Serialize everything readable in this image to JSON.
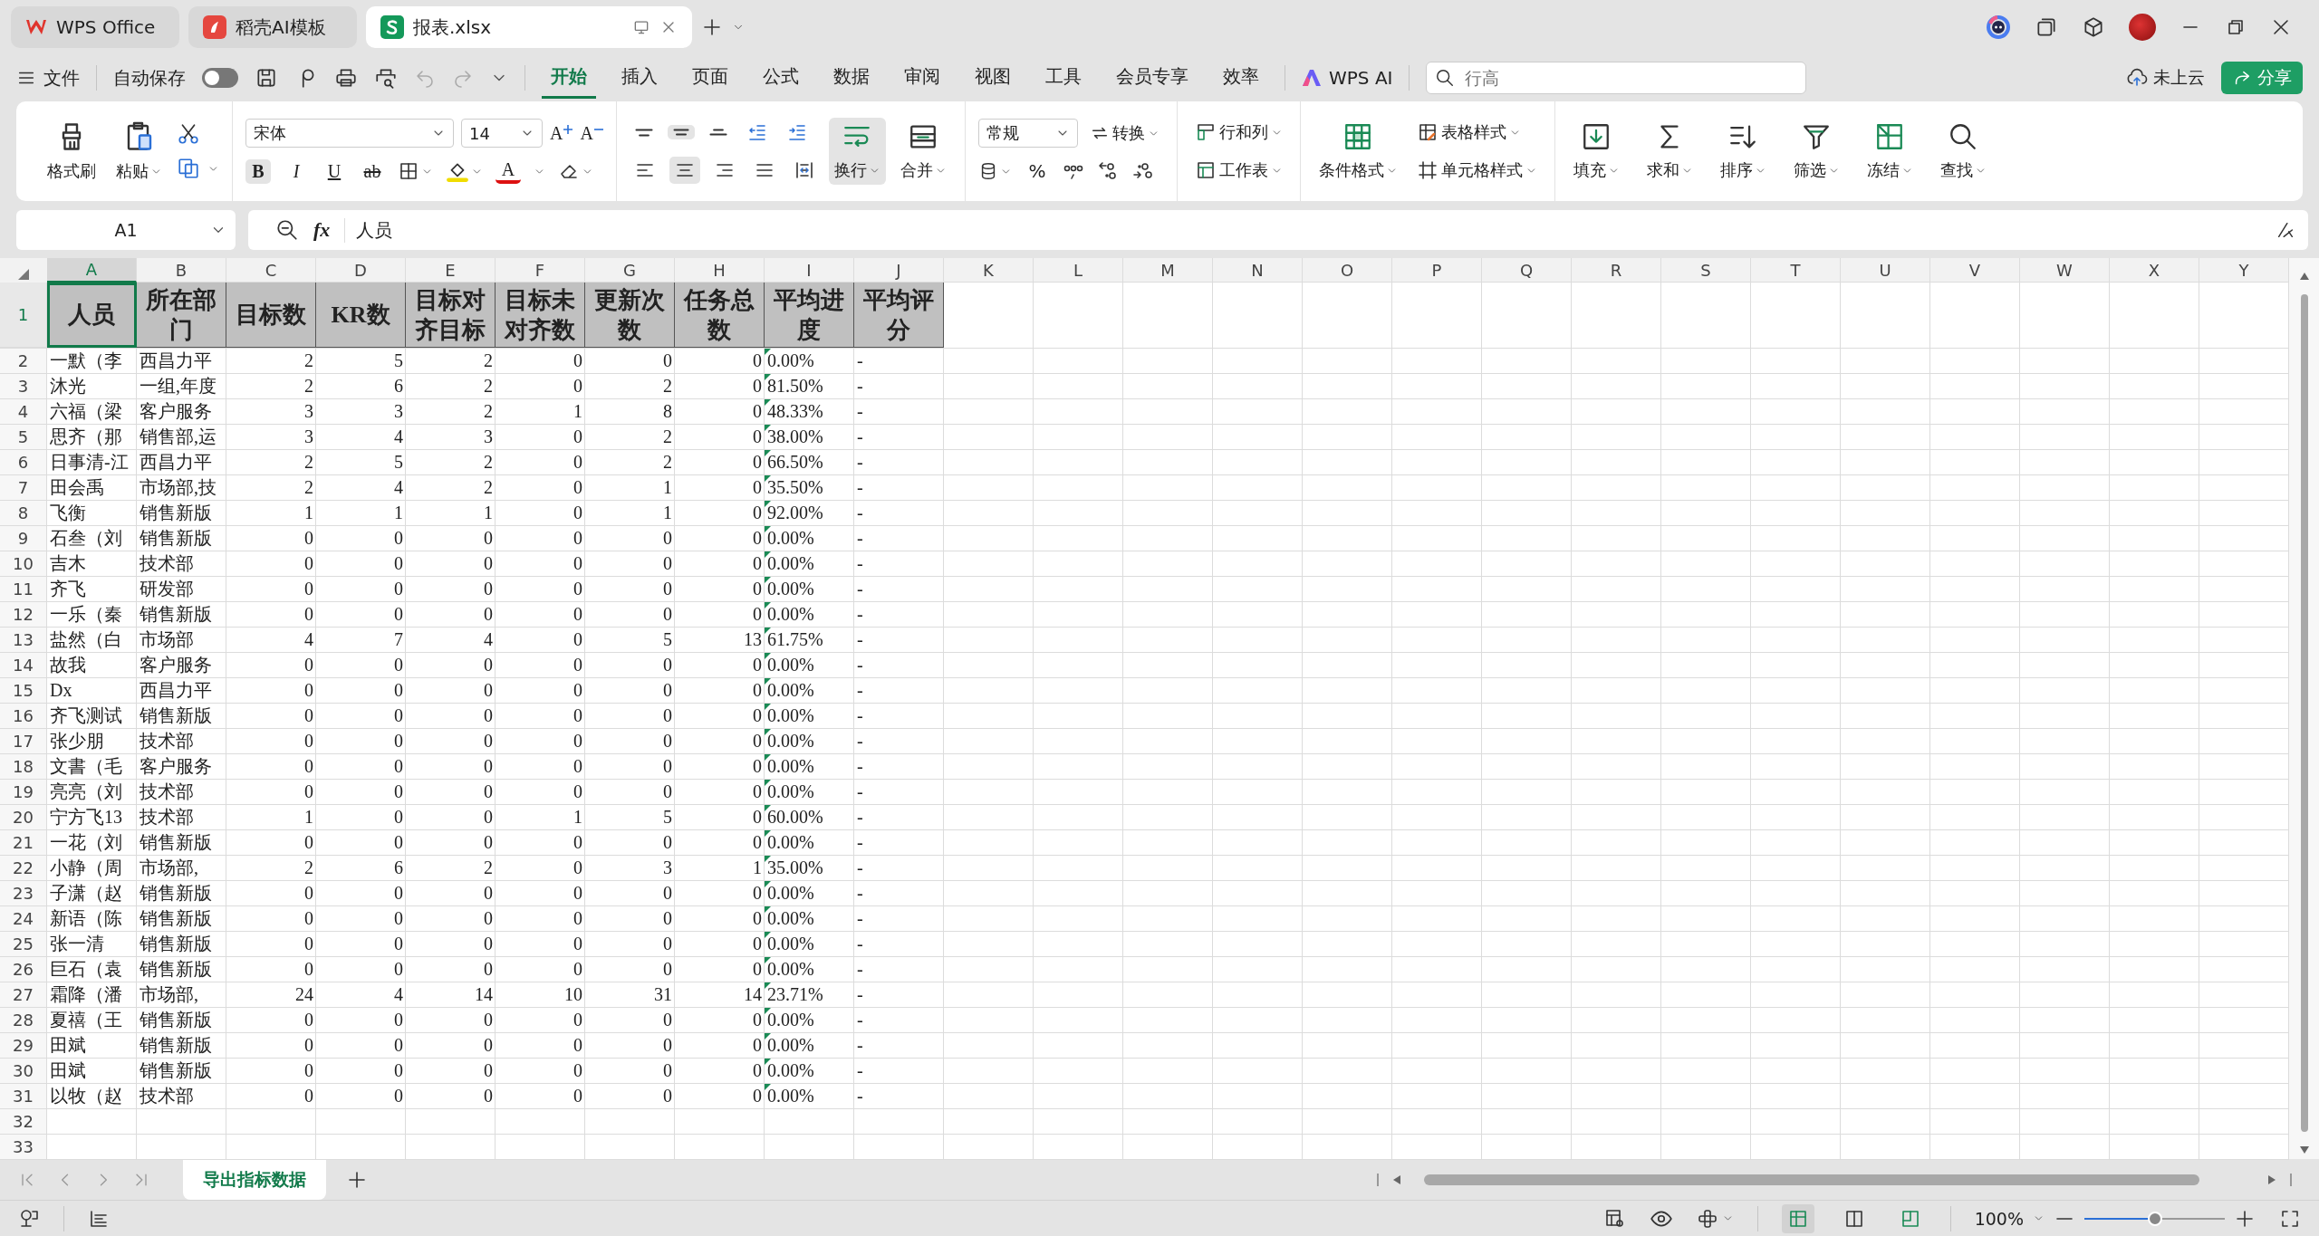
{
  "title_tabs": [
    {
      "label": "WPS Office",
      "kind": "wps",
      "selected": false
    },
    {
      "label": "稻壳AI模板",
      "kind": "docer",
      "selected": false
    },
    {
      "label": "报表.xlsx",
      "kind": "sheet",
      "selected": true
    }
  ],
  "menu": {
    "file": "文件",
    "autosave": {
      "label": "自动保存",
      "on": false
    },
    "tabs": [
      {
        "label": "开始",
        "selected": true
      },
      {
        "label": "插入",
        "selected": false
      },
      {
        "label": "页面",
        "selected": false
      },
      {
        "label": "公式",
        "selected": false
      },
      {
        "label": "数据",
        "selected": false
      },
      {
        "label": "审阅",
        "selected": false
      },
      {
        "label": "视图",
        "selected": false
      },
      {
        "label": "工具",
        "selected": false
      },
      {
        "label": "会员专享",
        "selected": false
      },
      {
        "label": "效率",
        "selected": false
      }
    ],
    "ai": "WPS AI",
    "search": {
      "placeholder": "行高"
    },
    "cloud": "未上云",
    "share": "分享"
  },
  "ribbon": {
    "clipboard": [
      "格式刷",
      "粘贴"
    ],
    "font": {
      "name": "宋体",
      "size": "14",
      "grow": "A",
      "shrink": "A",
      "bold": {
        "label": "B",
        "on": true
      },
      "italic": "I",
      "underline": "U",
      "strike": "ab",
      "color_letter": "A"
    },
    "align": [
      {
        "kind": "top",
        "selected": false
      },
      {
        "kind": "middle",
        "selected": true
      },
      {
        "kind": "bottom",
        "selected": false
      },
      {
        "kind": "outdent",
        "selected": false
      },
      {
        "kind": "indent",
        "selected": false
      },
      {
        "kind": "left",
        "selected": false
      },
      {
        "kind": "center",
        "selected": true
      },
      {
        "kind": "right",
        "selected": false
      },
      {
        "kind": "justify",
        "selected": false
      },
      {
        "kind": "distributed",
        "selected": false
      }
    ],
    "wrap": {
      "label": "换行",
      "on": true
    },
    "merge": "合并",
    "number_format": "常规",
    "convert": "转换",
    "percent": "%",
    "rows_cols": "行和列",
    "worksheet": "工作表",
    "cond_format": "条件格式",
    "table_style": "表格样式",
    "cell_style": "单元格样式",
    "tools": [
      {
        "label": "填充",
        "kind": "fill"
      },
      {
        "label": "求和",
        "kind": "sum"
      },
      {
        "label": "排序",
        "kind": "sort"
      },
      {
        "label": "筛选",
        "kind": "filter"
      },
      {
        "label": "冻结",
        "kind": "freeze"
      },
      {
        "label": "查找",
        "kind": "find"
      }
    ]
  },
  "formula": {
    "name_box": "A1",
    "fx": "fx",
    "value": "人员"
  },
  "sheet": {
    "columns": [
      {
        "letter": "A",
        "header": "人员",
        "kind": "text",
        "selected": true
      },
      {
        "letter": "B",
        "header": "所在部门",
        "kind": "text",
        "selected": false
      },
      {
        "letter": "C",
        "header": "目标数",
        "kind": "number",
        "selected": false
      },
      {
        "letter": "D",
        "header": "KR数",
        "kind": "number",
        "selected": false
      },
      {
        "letter": "E",
        "header": "目标对齐目标",
        "kind": "number",
        "selected": false
      },
      {
        "letter": "F",
        "header": "目标未对齐数",
        "kind": "number",
        "selected": false
      },
      {
        "letter": "G",
        "header": "更新次数",
        "kind": "number",
        "selected": false
      },
      {
        "letter": "H",
        "header": "任务总数",
        "kind": "number",
        "selected": false
      },
      {
        "letter": "I",
        "header": "平均进度",
        "kind": "percent",
        "selected": false
      },
      {
        "letter": "J",
        "header": "平均评分",
        "kind": "text",
        "selected": false
      }
    ],
    "empty_columns": [
      "K",
      "L",
      "M",
      "N",
      "O",
      "P",
      "Q",
      "R",
      "S",
      "T",
      "U",
      "V",
      "W",
      "X",
      "Y"
    ],
    "header_row": {
      "number": "1",
      "selected": true
    },
    "rows": [
      {
        "number": "2",
        "cells": [
          "一默（李",
          "西昌力平",
          "2",
          "5",
          "2",
          "0",
          "0",
          "0",
          "0.00%",
          "-"
        ]
      },
      {
        "number": "3",
        "cells": [
          "沐光",
          "一组,年度",
          "2",
          "6",
          "2",
          "0",
          "2",
          "0",
          "81.50%",
          "-"
        ]
      },
      {
        "number": "4",
        "cells": [
          "六福（梁",
          "客户服务",
          "3",
          "3",
          "2",
          "1",
          "8",
          "0",
          "48.33%",
          "-"
        ]
      },
      {
        "number": "5",
        "cells": [
          "思齐（那",
          "销售部,运",
          "3",
          "4",
          "3",
          "0",
          "2",
          "0",
          "38.00%",
          "-"
        ]
      },
      {
        "number": "6",
        "cells": [
          "日事清-江",
          "西昌力平",
          "2",
          "5",
          "2",
          "0",
          "2",
          "0",
          "66.50%",
          "-"
        ]
      },
      {
        "number": "7",
        "cells": [
          "田会禹",
          "市场部,技",
          "2",
          "4",
          "2",
          "0",
          "1",
          "0",
          "35.50%",
          "-"
        ]
      },
      {
        "number": "8",
        "cells": [
          "飞衡",
          "销售新版",
          "1",
          "1",
          "1",
          "0",
          "1",
          "0",
          "92.00%",
          "-"
        ]
      },
      {
        "number": "9",
        "cells": [
          "石叁（刘",
          "销售新版",
          "0",
          "0",
          "0",
          "0",
          "0",
          "0",
          "0.00%",
          "-"
        ]
      },
      {
        "number": "10",
        "cells": [
          "吉木",
          "技术部",
          "0",
          "0",
          "0",
          "0",
          "0",
          "0",
          "0.00%",
          "-"
        ]
      },
      {
        "number": "11",
        "cells": [
          "齐飞",
          "研发部",
          "0",
          "0",
          "0",
          "0",
          "0",
          "0",
          "0.00%",
          "-"
        ]
      },
      {
        "number": "12",
        "cells": [
          "一乐（秦",
          "销售新版",
          "0",
          "0",
          "0",
          "0",
          "0",
          "0",
          "0.00%",
          "-"
        ]
      },
      {
        "number": "13",
        "cells": [
          "盐然（白",
          "市场部",
          "4",
          "7",
          "4",
          "0",
          "5",
          "13",
          "61.75%",
          "-"
        ]
      },
      {
        "number": "14",
        "cells": [
          "故我",
          "客户服务",
          "0",
          "0",
          "0",
          "0",
          "0",
          "0",
          "0.00%",
          "-"
        ]
      },
      {
        "number": "15",
        "cells": [
          "Dx",
          "西昌力平",
          "0",
          "0",
          "0",
          "0",
          "0",
          "0",
          "0.00%",
          "-"
        ]
      },
      {
        "number": "16",
        "cells": [
          "齐飞测试",
          "销售新版",
          "0",
          "0",
          "0",
          "0",
          "0",
          "0",
          "0.00%",
          "-"
        ]
      },
      {
        "number": "17",
        "cells": [
          "张少朋",
          "技术部",
          "0",
          "0",
          "0",
          "0",
          "0",
          "0",
          "0.00%",
          "-"
        ]
      },
      {
        "number": "18",
        "cells": [
          "文書（毛",
          "客户服务",
          "0",
          "0",
          "0",
          "0",
          "0",
          "0",
          "0.00%",
          "-"
        ]
      },
      {
        "number": "19",
        "cells": [
          "亮亮（刘",
          "技术部",
          "0",
          "0",
          "0",
          "0",
          "0",
          "0",
          "0.00%",
          "-"
        ]
      },
      {
        "number": "20",
        "cells": [
          "宁方飞13",
          "技术部",
          "1",
          "0",
          "0",
          "1",
          "5",
          "0",
          "60.00%",
          "-"
        ]
      },
      {
        "number": "21",
        "cells": [
          "一花（刘",
          "销售新版",
          "0",
          "0",
          "0",
          "0",
          "0",
          "0",
          "0.00%",
          "-"
        ]
      },
      {
        "number": "22",
        "cells": [
          "小静（周",
          "市场部,",
          "2",
          "6",
          "2",
          "0",
          "3",
          "1",
          "35.00%",
          "-"
        ]
      },
      {
        "number": "23",
        "cells": [
          "子潇（赵",
          "销售新版",
          "0",
          "0",
          "0",
          "0",
          "0",
          "0",
          "0.00%",
          "-"
        ]
      },
      {
        "number": "24",
        "cells": [
          "新语（陈",
          "销售新版",
          "0",
          "0",
          "0",
          "0",
          "0",
          "0",
          "0.00%",
          "-"
        ]
      },
      {
        "number": "25",
        "cells": [
          "张一清",
          "销售新版",
          "0",
          "0",
          "0",
          "0",
          "0",
          "0",
          "0.00%",
          "-"
        ]
      },
      {
        "number": "26",
        "cells": [
          "巨石（袁",
          "销售新版",
          "0",
          "0",
          "0",
          "0",
          "0",
          "0",
          "0.00%",
          "-"
        ]
      },
      {
        "number": "27",
        "cells": [
          "霜降（潘",
          "市场部,",
          "24",
          "4",
          "14",
          "10",
          "31",
          "14",
          "23.71%",
          "-"
        ]
      },
      {
        "number": "28",
        "cells": [
          "夏禧（王",
          "销售新版",
          "0",
          "0",
          "0",
          "0",
          "0",
          "0",
          "0.00%",
          "-"
        ]
      },
      {
        "number": "29",
        "cells": [
          "田斌",
          "销售新版",
          "0",
          "0",
          "0",
          "0",
          "0",
          "0",
          "0.00%",
          "-"
        ]
      },
      {
        "number": "30",
        "cells": [
          "田斌",
          "销售新版",
          "0",
          "0",
          "0",
          "0",
          "0",
          "0",
          "0.00%",
          "-"
        ]
      },
      {
        "number": "31",
        "cells": [
          "以牧（赵",
          "技术部",
          "0",
          "0",
          "0",
          "0",
          "0",
          "0",
          "0.00%",
          "-"
        ]
      }
    ],
    "empty_rows": [
      "32",
      "33"
    ]
  },
  "sheet_tabs": [
    {
      "label": "导出指标数据",
      "selected": true
    }
  ],
  "status": {
    "views": [
      {
        "kind": "normal",
        "selected": true
      },
      {
        "kind": "split",
        "selected": false
      },
      {
        "kind": "page",
        "selected": false
      }
    ],
    "zoom": "100%",
    "zoom_slider": {
      "level": 0.5
    }
  }
}
